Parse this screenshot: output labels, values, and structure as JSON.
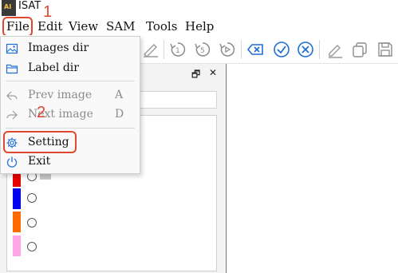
{
  "app": {
    "title": "ISAT",
    "logo_text": "AI"
  },
  "menubar": {
    "items": [
      "File",
      "Edit",
      "View",
      "SAM",
      "Tools",
      "Help"
    ]
  },
  "annotations": {
    "step1": "1",
    "step2": "2"
  },
  "file_menu": {
    "items": [
      {
        "label": "Images dir",
        "icon": "image-icon",
        "shortcut": "",
        "enabled": true
      },
      {
        "label": "Label dir",
        "icon": "folder-icon",
        "shortcut": "",
        "enabled": true
      },
      {
        "label": "Prev image",
        "icon": "prev-arrow-icon",
        "shortcut": "A",
        "enabled": false
      },
      {
        "label": "Next image",
        "icon": "next-arrow-icon",
        "shortcut": "D",
        "enabled": false
      },
      {
        "label": "Setting",
        "icon": "gear-icon",
        "shortcut": "",
        "enabled": true
      },
      {
        "label": "Exit",
        "icon": "power-icon",
        "shortcut": "",
        "enabled": true
      }
    ]
  },
  "dock": {
    "float_glyph": "🗗",
    "close_glyph": "✕"
  },
  "labels": [
    {
      "color": "#e60000"
    },
    {
      "color": "#0000ee"
    },
    {
      "color": "#ff6a00"
    },
    {
      "color": "#ffa6e9"
    }
  ],
  "colors": {
    "accent_blue": "#1f6fd6",
    "annotation_red": "#e0472f"
  }
}
